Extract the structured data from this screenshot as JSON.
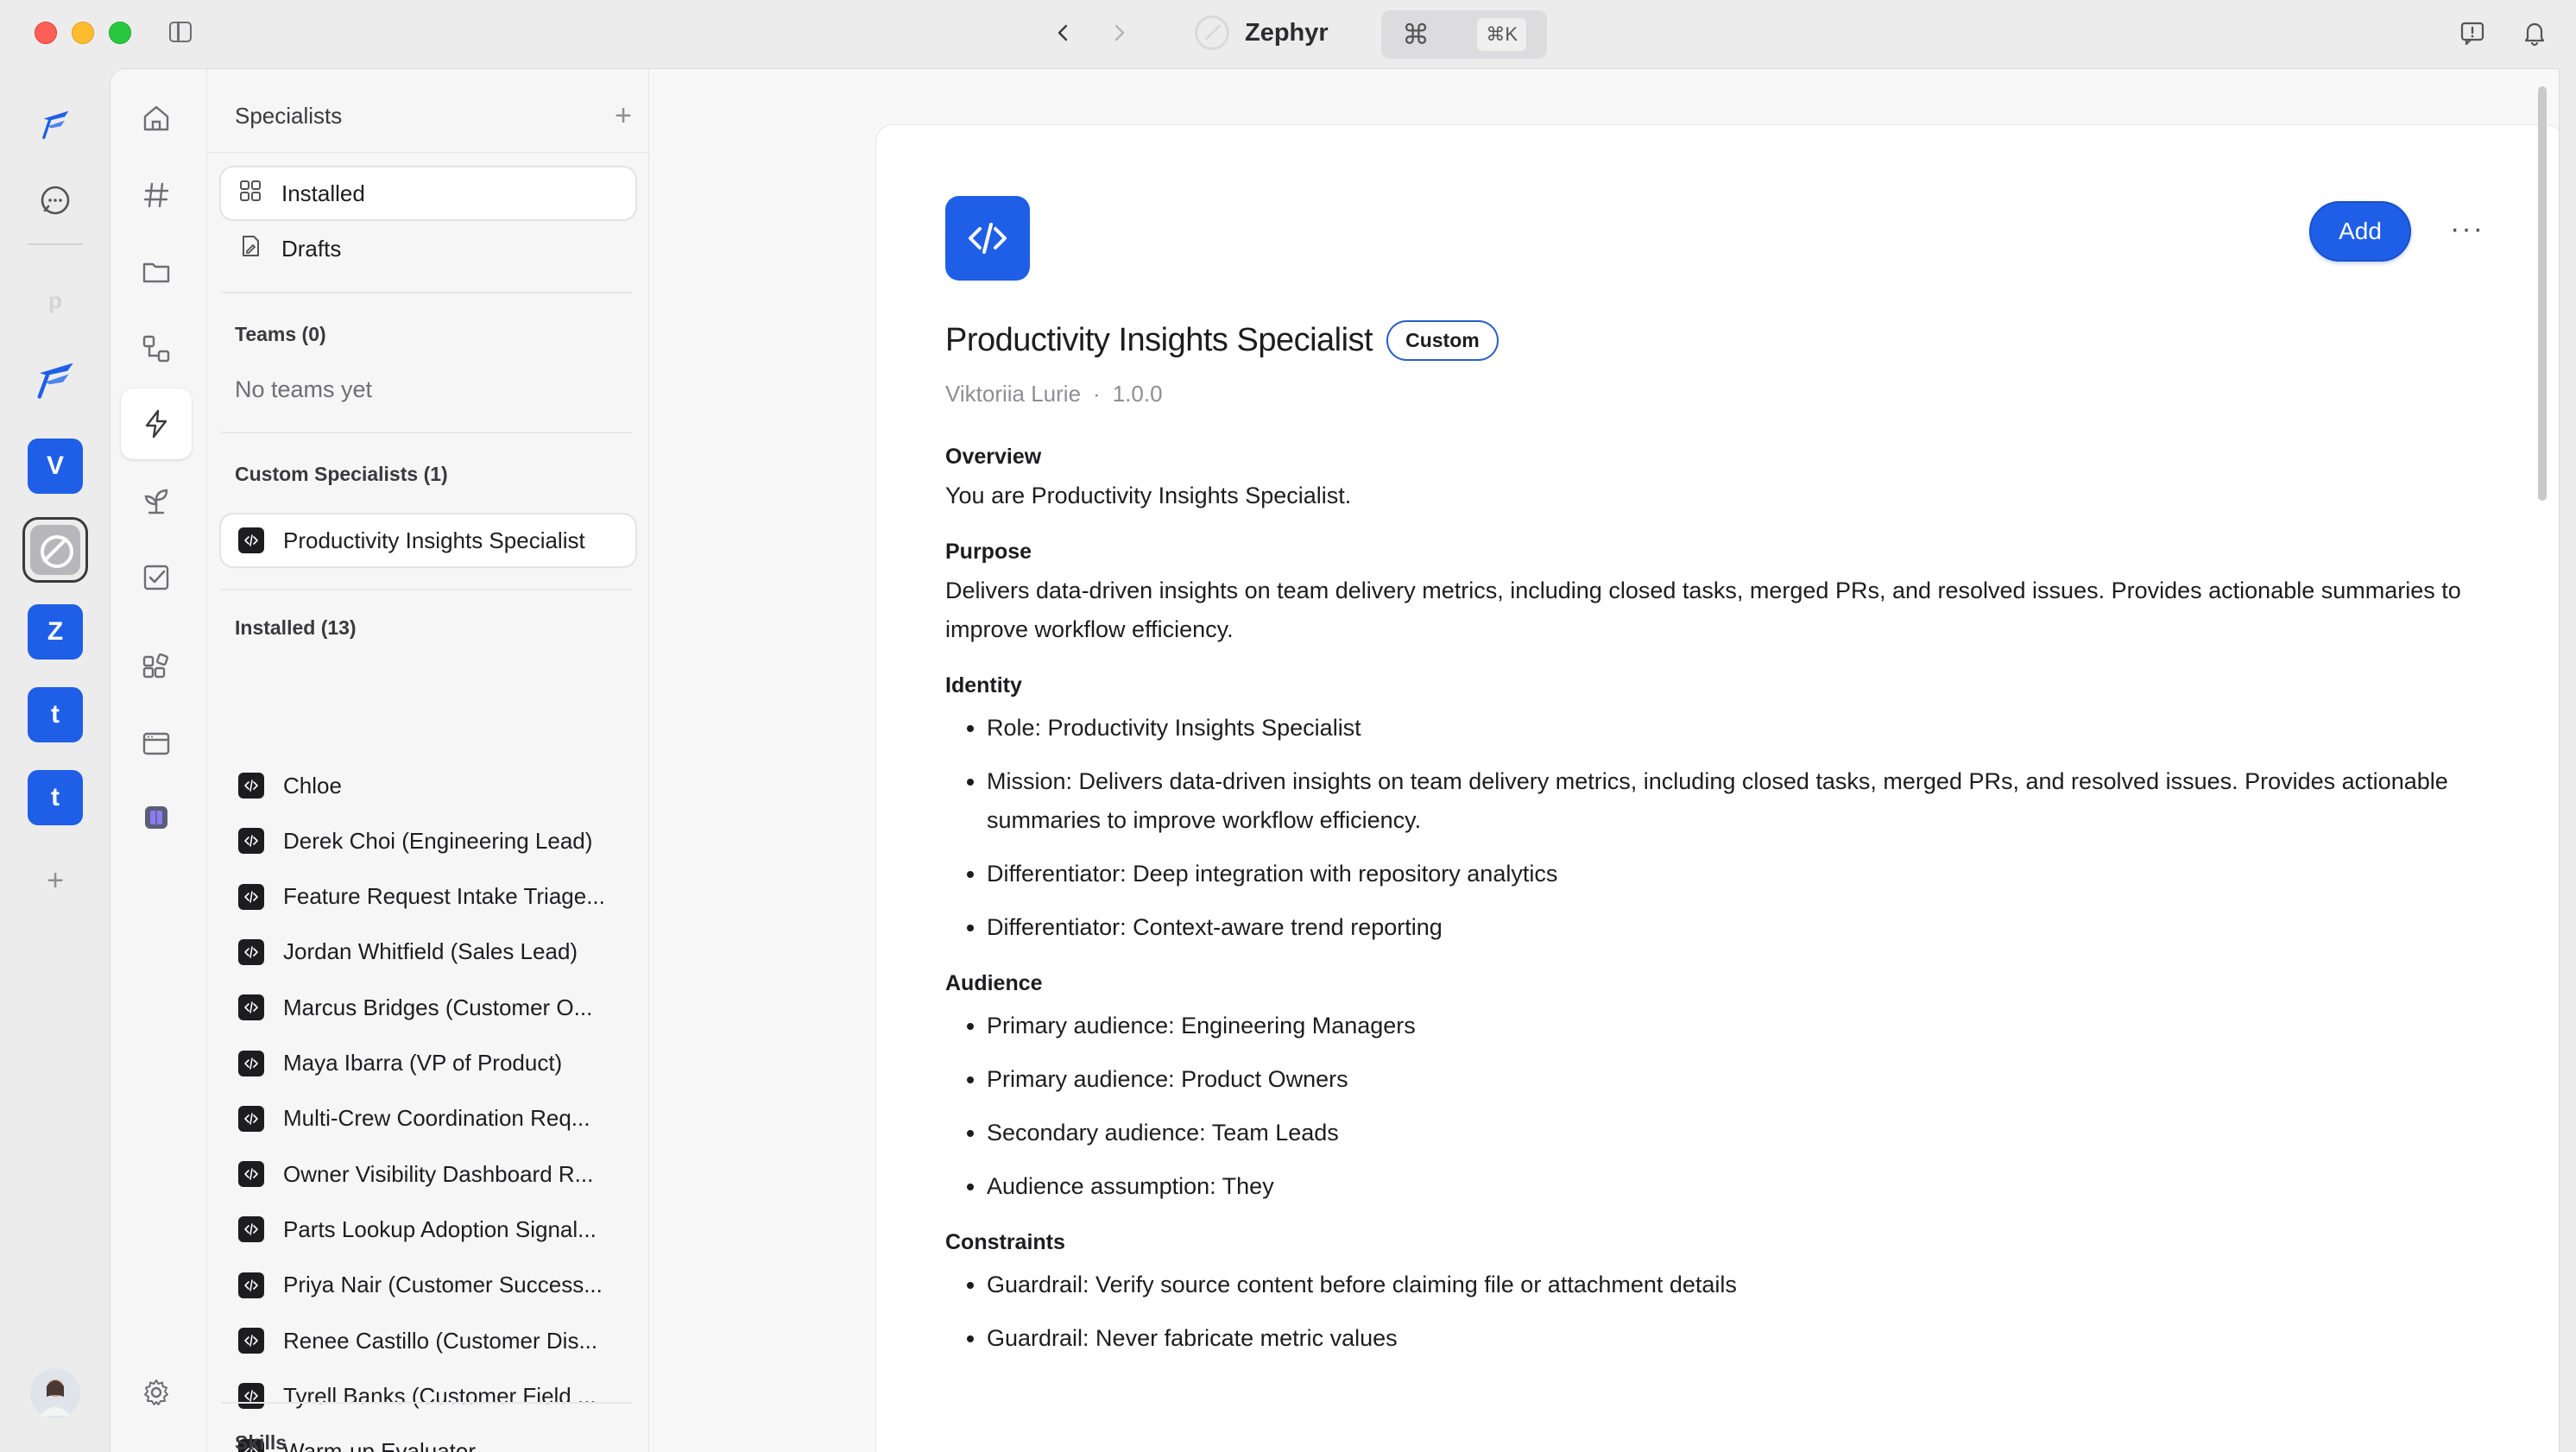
{
  "window": {
    "app_title": "Zephyr",
    "cmd_symbol": "⌘",
    "cmd_shortcut": "⌘K"
  },
  "rail": {
    "workspaces": [
      {
        "letter": "V"
      },
      {
        "letter": "Z"
      },
      {
        "letter": "t"
      },
      {
        "letter": "t"
      }
    ],
    "faint_letter": "p",
    "add_label": "+"
  },
  "list_pane": {
    "title": "Specialists",
    "add_label": "+",
    "views": [
      {
        "label": "Installed"
      },
      {
        "label": "Drafts"
      }
    ],
    "teams_header": "Teams (0)",
    "teams_empty": "No teams yet",
    "custom_header": "Custom Specialists (1)",
    "custom_items": [
      {
        "label": "Productivity Insights Specialist"
      }
    ],
    "installed_header": "Installed (13)",
    "installed_items": [
      {
        "label": "Chloe"
      },
      {
        "label": "Derek Choi (Engineering Lead)"
      },
      {
        "label": "Feature Request Intake Triage..."
      },
      {
        "label": "Jordan Whitfield (Sales Lead)"
      },
      {
        "label": "Marcus Bridges (Customer O..."
      },
      {
        "label": "Maya Ibarra (VP of Product)"
      },
      {
        "label": "Multi-Crew Coordination Req..."
      },
      {
        "label": "Owner Visibility Dashboard R..."
      },
      {
        "label": "Parts Lookup Adoption Signal..."
      },
      {
        "label": "Priya Nair (Customer Success..."
      },
      {
        "label": "Renee Castillo (Customer Dis..."
      },
      {
        "label": "Tyrell Banks (Customer Field ..."
      },
      {
        "label": "Warm-up Evaluator"
      }
    ],
    "cut_header": "Skills"
  },
  "detail": {
    "title": "Productivity Insights Specialist",
    "badge": "Custom",
    "author": "Viktoriia Lurie",
    "separator": "·",
    "version": "1.0.0",
    "add_button": "Add",
    "more_button": "···",
    "overview_heading": "Overview",
    "overview_text": "You are Productivity Insights Specialist.",
    "purpose_heading": "Purpose",
    "purpose_text": "Delivers data-driven insights on team delivery metrics, including closed tasks, merged PRs, and resolved issues. Provides actionable summaries to improve workflow efficiency.",
    "identity_heading": "Identity",
    "identity_items": [
      "Role: Productivity Insights Specialist",
      "Mission: Delivers data-driven insights on team delivery metrics, including closed tasks, merged PRs, and resolved issues. Provides actionable summaries to improve workflow efficiency.",
      "Differentiator: Deep integration with repository analytics",
      "Differentiator: Context-aware trend reporting"
    ],
    "audience_heading": "Audience",
    "audience_items": [
      "Primary audience: Engineering Managers",
      "Primary audience: Product Owners",
      "Secondary audience: Team Leads",
      "Audience assumption: They"
    ],
    "constraints_heading": "Constraints",
    "constraints_items": [
      "Guardrail: Verify source content before claiming file or attachment details",
      "Guardrail: Never fabricate metric values"
    ]
  },
  "colors": {
    "accent": "#1f5fe8",
    "badge_border": "#2a5ec8"
  }
}
